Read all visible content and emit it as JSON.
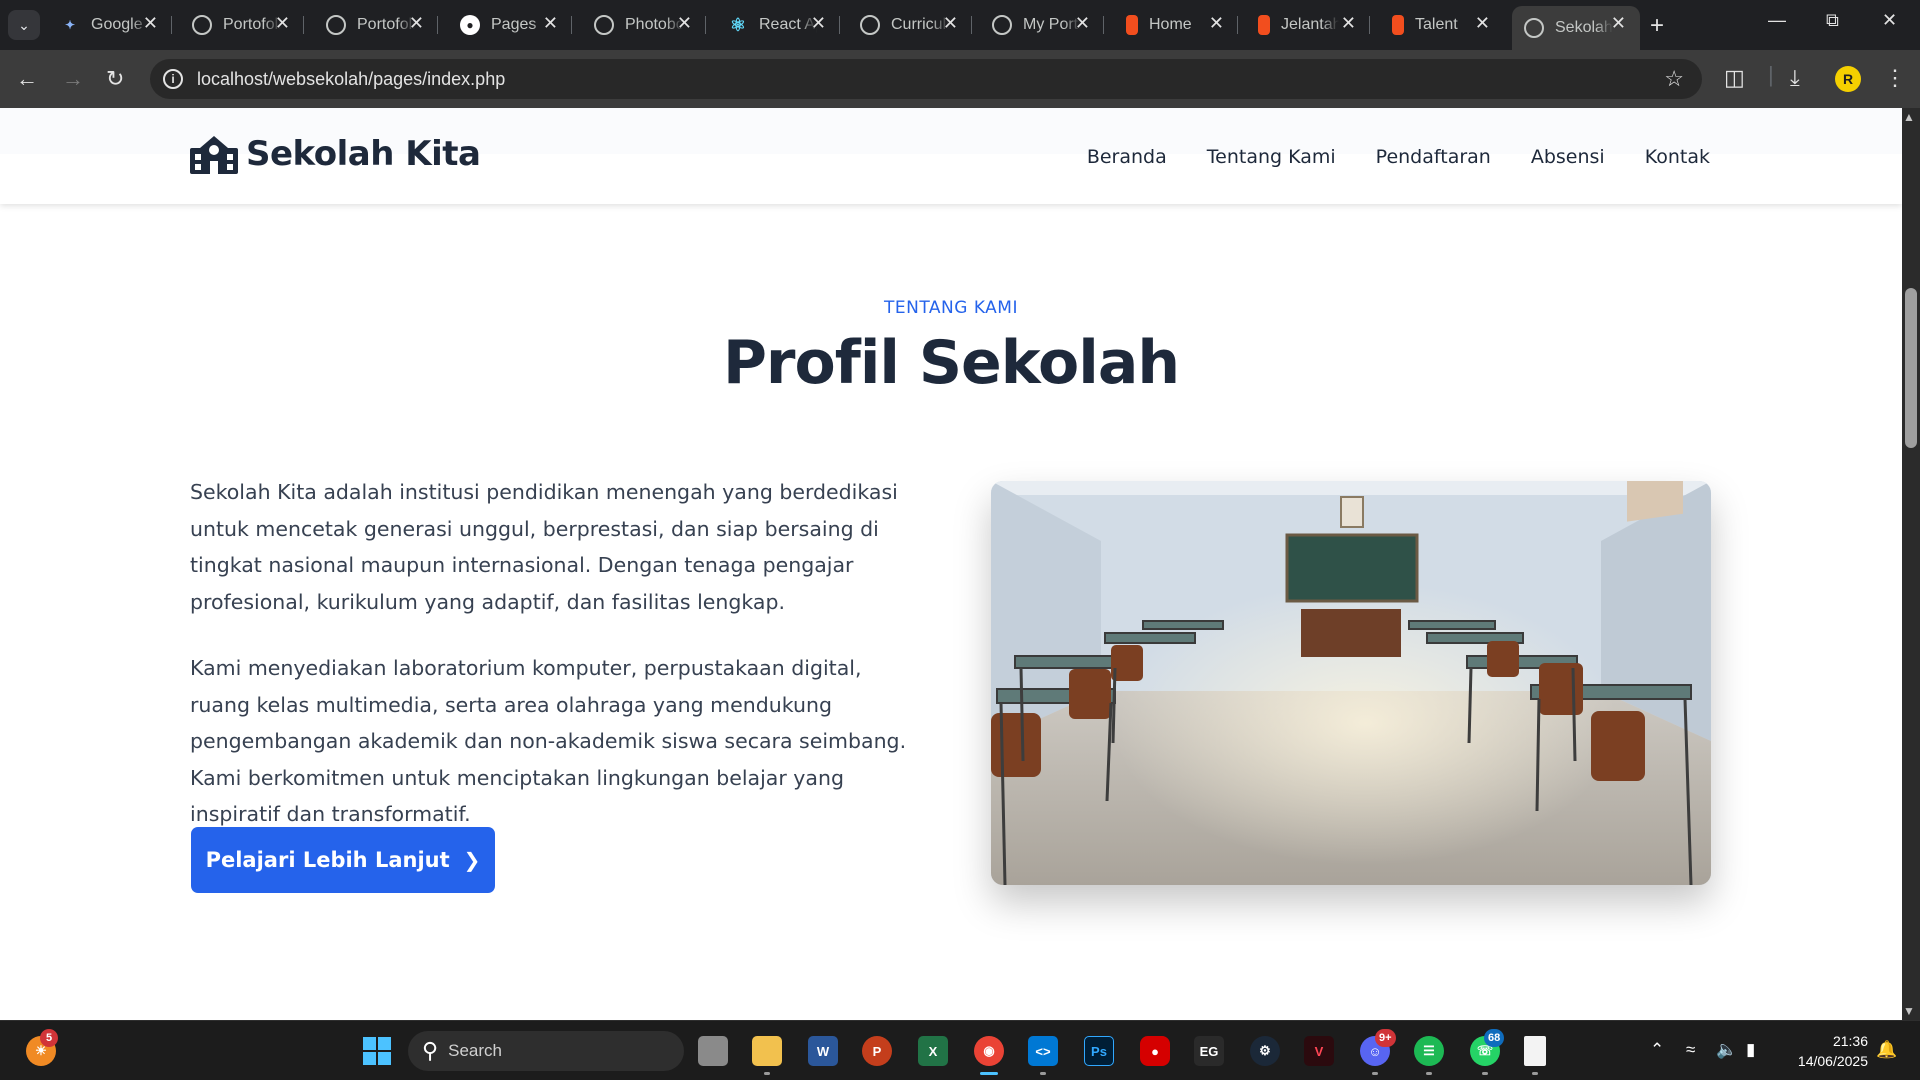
{
  "browser": {
    "tabs": [
      {
        "label": "Google",
        "icon": "gemini-icon",
        "color": "#8ab4f8"
      },
      {
        "label": "Portofolio",
        "icon": "globe-icon",
        "color": "#c4c7c5"
      },
      {
        "label": "Portofolio",
        "icon": "globe-icon",
        "color": "#c4c7c5"
      },
      {
        "label": "Pages",
        "icon": "github-icon",
        "color": "#ffffff"
      },
      {
        "label": "Photoboo",
        "icon": "globe-icon",
        "color": "#c4c7c5"
      },
      {
        "label": "React App",
        "icon": "react-icon",
        "color": "#61dafb"
      },
      {
        "label": "Curriculum",
        "icon": "world-icon",
        "color": "#c4c7c5"
      },
      {
        "label": "My Portfolio",
        "icon": "globe-icon",
        "color": "#c4c7c5"
      },
      {
        "label": "Home",
        "icon": "figma-icon",
        "color": "#f24e1e"
      },
      {
        "label": "Jelantah",
        "icon": "figma-icon",
        "color": "#f24e1e"
      },
      {
        "label": "Talent",
        "icon": "figma-icon",
        "color": "#f24e1e"
      },
      {
        "label": "Sekolah",
        "icon": "globe-icon",
        "color": "#c4c7c5"
      }
    ],
    "active_tab_index": 11,
    "url": "localhost/websekolah/pages/index.php",
    "profile_initial": "R"
  },
  "site": {
    "brand": "Sekolah Kita",
    "nav": [
      "Beranda",
      "Tentang Kami",
      "Pendaftaran",
      "Absensi",
      "Kontak"
    ],
    "section_label": "TENTANG KAMI",
    "section_title": "Profil Sekolah",
    "paragraphs": [
      "Sekolah Kita adalah institusi pendidikan menengah yang berdedikasi untuk mencetak generasi unggul, berprestasi, dan siap bersaing di tingkat nasional maupun internasional. Dengan tenaga pengajar profesional, kurikulum yang adaptif, dan fasilitas lengkap.",
      "Kami menyediakan laboratorium komputer, perpustakaan digital, ruang kelas multimedia, serta area olahraga yang mendukung pengembangan akademik dan non-akademik siswa secara seimbang. Kami berkomitmen untuk menciptakan lingkungan belajar yang inspiratif dan transformatif."
    ],
    "cta_label": "Pelajari Lebih Lanjut",
    "image_alt": "classroom-photo",
    "accent_color": "#2563eb",
    "text_color": "#1e293b"
  },
  "taskbar": {
    "search_label": "Search",
    "weather_badge": "5",
    "discord_badge": "9+",
    "whatsapp_badge": "68",
    "time": "21:36",
    "date": "14/06/2025"
  }
}
